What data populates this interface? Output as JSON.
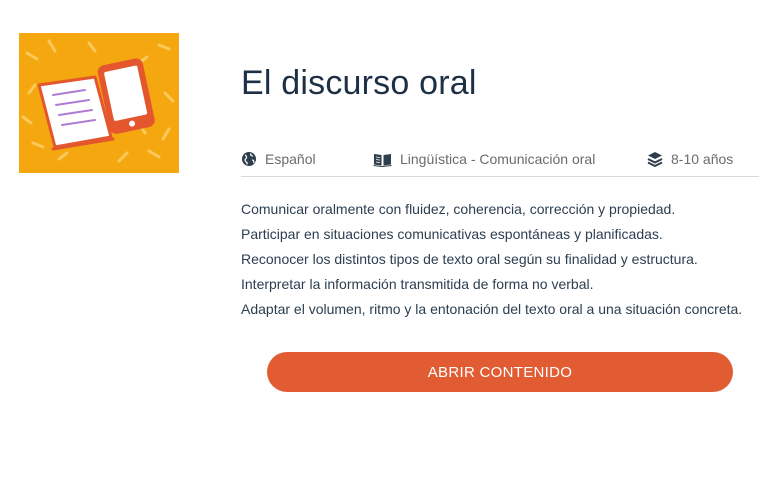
{
  "resource": {
    "title": "El discurso oral",
    "thumbnail_icon": "open-book-tablet-icon",
    "colors": {
      "thumbnail_bg": "#f5a710",
      "accent": "#e25c33",
      "title": "#1d3046"
    }
  },
  "meta": {
    "language": {
      "icon": "globe-icon",
      "label": "Español"
    },
    "subject": {
      "icon": "book-icon",
      "label": "Lingüística - Comunicación oral"
    },
    "age": {
      "icon": "layers-icon",
      "label": "8-10 años"
    }
  },
  "objectives": [
    "Comunicar oralmente con fluidez, coherencia, corrección y propiedad.",
    "Participar en situaciones comunicativas espontáneas y planificadas.",
    "Reconocer los distintos tipos de texto oral según su finalidad y estructura.",
    "Interpretar la información transmitida de forma no verbal.",
    "Adaptar el volumen, ritmo y la entonación del texto oral a una situación concreta."
  ],
  "actions": {
    "open_label": "ABRIR CONTENIDO"
  }
}
